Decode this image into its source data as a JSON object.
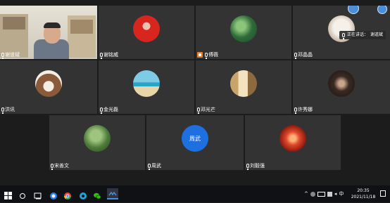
{
  "participants": [
    {
      "name": "谢道斌",
      "avatar": "video"
    },
    {
      "name": "谢铭威",
      "avatar": "red-photo"
    },
    {
      "name": "傅薇",
      "avatar": "green-photo",
      "host": true
    },
    {
      "name": "邓晶晶",
      "avatar": "white-photo"
    },
    {
      "name": "洪讯",
      "avatar": "hair-photo"
    },
    {
      "name": "金光磊",
      "avatar": "beach-photo"
    },
    {
      "name": "邓光芒",
      "avatar": "room-photo"
    },
    {
      "name": "许秀娜",
      "avatar": "dark-photo"
    },
    {
      "name": "宋善文",
      "avatar": "tree-photo"
    },
    {
      "name": "周武",
      "avatar": "text-avatar",
      "avatar_text": "周武"
    },
    {
      "name": "刘毅强",
      "avatar": "fire-photo"
    }
  ],
  "speaking_indicator": {
    "prefix": "正在讲话：",
    "name": "谢道斌"
  },
  "taskbar": {
    "time": "20:35",
    "date": "2021/11/18",
    "lang": "中"
  },
  "colors": {
    "tile_bg": "#333333",
    "gap_bg": "#1c1c1c",
    "host_badge": "#e8802b",
    "text_avatar_bg": "#1e6fe0",
    "taskbar_bg": "#101114"
  }
}
